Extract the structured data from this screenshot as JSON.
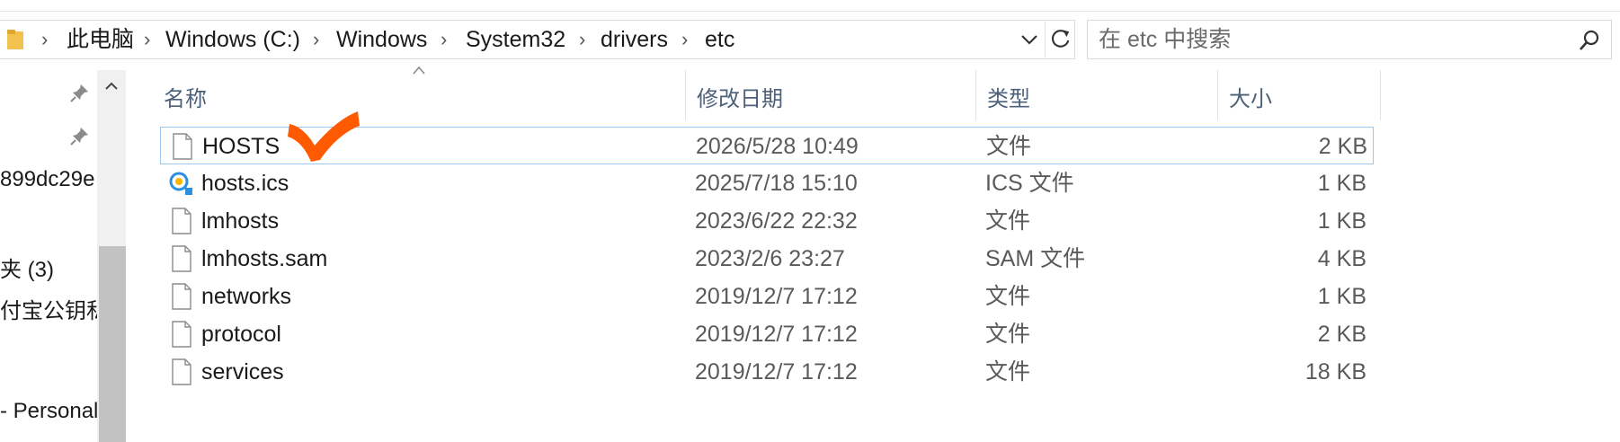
{
  "breadcrumb": [
    "此电脑",
    "Windows (C:)",
    "Windows",
    "System32",
    "drivers",
    "etc"
  ],
  "search": {
    "placeholder": "在 etc 中搜索"
  },
  "nav": {
    "items": [
      {
        "label": "899dc29e"
      },
      {
        "label": "夹 (3)"
      },
      {
        "label": "付宝公钥私"
      },
      {
        "label": "- Personal"
      }
    ]
  },
  "columns": {
    "name": "名称",
    "modified": "修改日期",
    "type": "类型",
    "size": "大小"
  },
  "files": [
    {
      "name": "HOSTS",
      "modified": "2026/5/28 10:49",
      "type": "文件",
      "size": "2 KB",
      "icon": "blank-file-icon",
      "selected": true
    },
    {
      "name": "hosts.ics",
      "modified": "2025/7/18 15:10",
      "type": "ICS 文件",
      "size": "1 KB",
      "icon": "ics-calendar-icon",
      "selected": false
    },
    {
      "name": "lmhosts",
      "modified": "2023/6/22 22:32",
      "type": "文件",
      "size": "1 KB",
      "icon": "blank-file-icon",
      "selected": false
    },
    {
      "name": "lmhosts.sam",
      "modified": "2023/2/6 23:27",
      "type": "SAM 文件",
      "size": "4 KB",
      "icon": "blank-file-icon",
      "selected": false
    },
    {
      "name": "networks",
      "modified": "2019/12/7 17:12",
      "type": "文件",
      "size": "1 KB",
      "icon": "blank-file-icon",
      "selected": false
    },
    {
      "name": "protocol",
      "modified": "2019/12/7 17:12",
      "type": "文件",
      "size": "2 KB",
      "icon": "blank-file-icon",
      "selected": false
    },
    {
      "name": "services",
      "modified": "2019/12/7 17:12",
      "type": "文件",
      "size": "18 KB",
      "icon": "blank-file-icon",
      "selected": false
    }
  ],
  "colors": {
    "accent": "#9cc9ef",
    "annotation": "#ff5a00",
    "header_text": "#4c607a"
  }
}
